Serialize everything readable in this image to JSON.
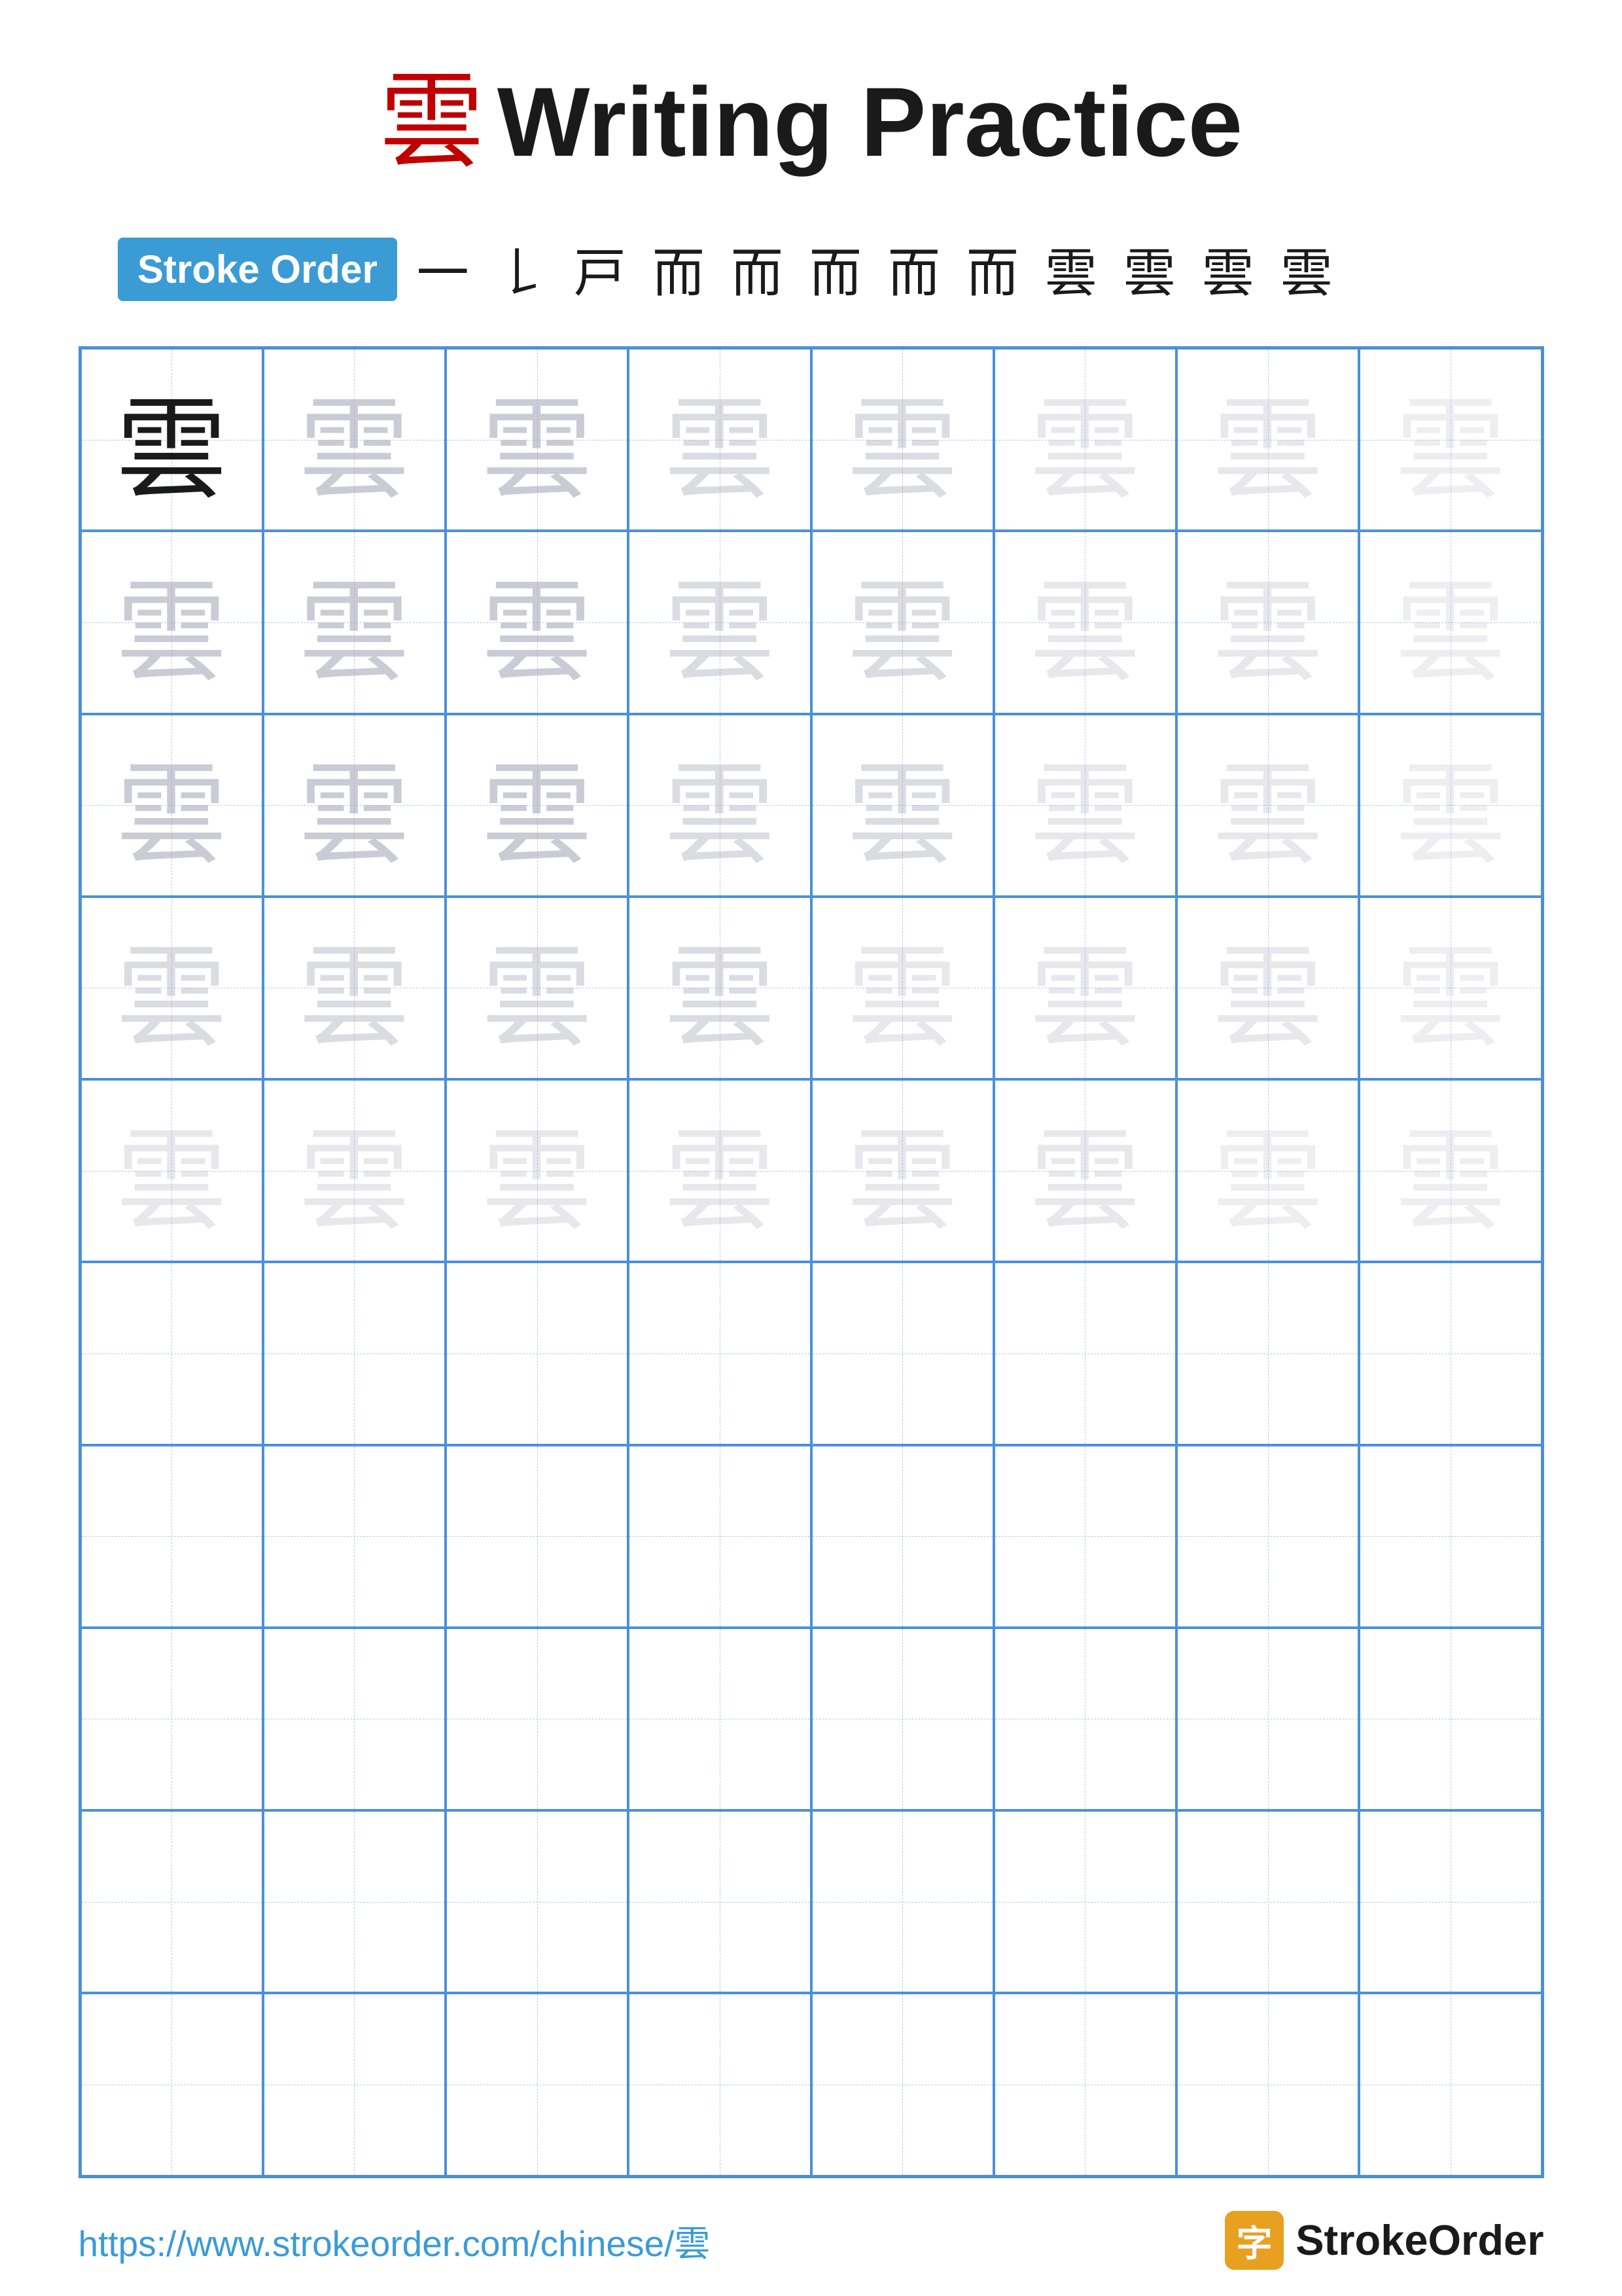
{
  "page": {
    "title_char": "雲",
    "title_text": "Writing Practice",
    "stroke_order_label": "Stroke Order",
    "stroke_order_sequence": "㇐ㄏ 戸 而 而 而 而 而 雲 雲 雲 雲",
    "stroke_steps": [
      "一",
      "𠄌",
      "戸",
      "而",
      "而",
      "而",
      "而",
      "而",
      "雲",
      "雲",
      "雲",
      "雲"
    ],
    "practice_char": "雲",
    "rows": 10,
    "cols": 8,
    "footer_url": "https://www.strokeorder.com/chinese/雲",
    "footer_brand": "StrokeOrder",
    "footer_icon_char": "字"
  }
}
